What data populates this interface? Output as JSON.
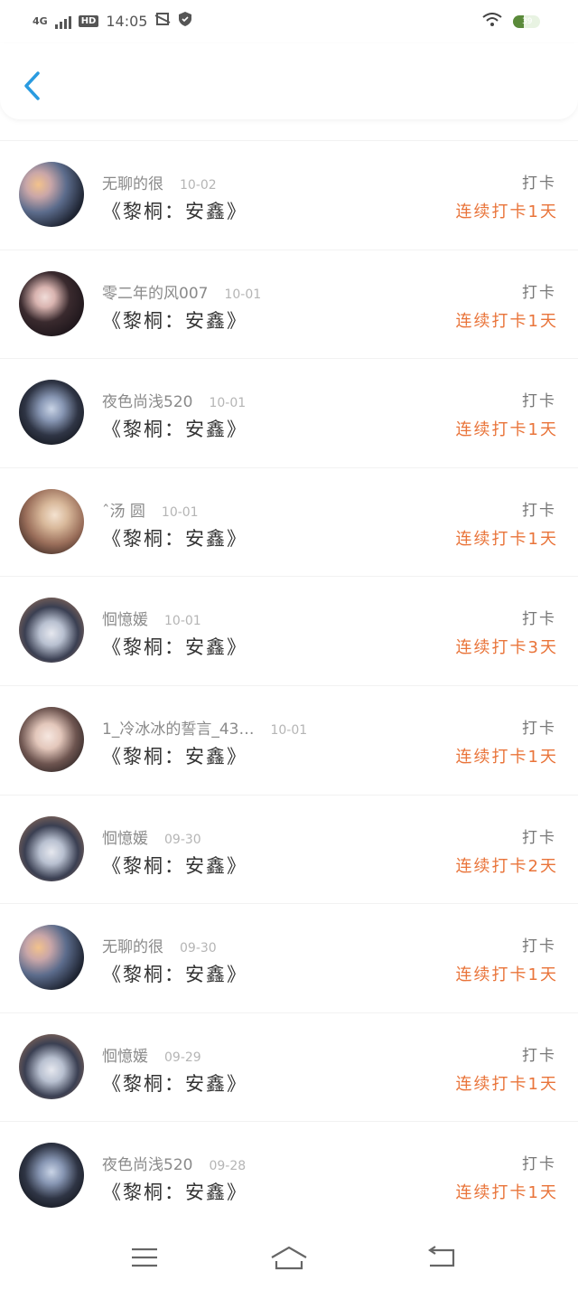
{
  "status": {
    "network": "4G",
    "hd": "HD",
    "time": "14:05",
    "battery_level": 39,
    "battery_label": "39"
  },
  "colors": {
    "accent_blue": "#2a9be0",
    "streak_orange": "#e9743a"
  },
  "entries": [
    {
      "name": "无聊的很",
      "date": "10-02",
      "book": "《黎桐：安鑫》",
      "action": "打卡",
      "streak": "连续打卡1天",
      "avatar": "avatar-sunset-mountain"
    },
    {
      "name": "零二年的风007",
      "date": "10-01",
      "book": "《黎桐：安鑫》",
      "action": "打卡",
      "streak": "连续打卡1天",
      "avatar": "avatar-girl-cat"
    },
    {
      "name": "夜色尚浅520",
      "date": "10-01",
      "book": "《黎桐：安鑫》",
      "action": "打卡",
      "streak": "连续打卡1天",
      "avatar": "avatar-couple"
    },
    {
      "name": "ˆ汤 圆",
      "date": "10-01",
      "book": "《黎桐：安鑫》",
      "action": "打卡",
      "streak": "连续打卡1天",
      "avatar": "avatar-girl-warm"
    },
    {
      "name": "恛憶媛",
      "date": "10-01",
      "book": "《黎桐：安鑫》",
      "action": "打卡",
      "streak": "连续打卡3天",
      "avatar": "avatar-girl-cap"
    },
    {
      "name": "1_冷冰冰的誓言_43…",
      "date": "10-01",
      "book": "《黎桐：安鑫》",
      "action": "打卡",
      "streak": "连续打卡1天",
      "avatar": "avatar-girl-car"
    },
    {
      "name": "恛憶媛",
      "date": "09-30",
      "book": "《黎桐：安鑫》",
      "action": "打卡",
      "streak": "连续打卡2天",
      "avatar": "avatar-girl-cap"
    },
    {
      "name": "无聊的很",
      "date": "09-30",
      "book": "《黎桐：安鑫》",
      "action": "打卡",
      "streak": "连续打卡1天",
      "avatar": "avatar-sunset-mountain"
    },
    {
      "name": "恛憶媛",
      "date": "09-29",
      "book": "《黎桐：安鑫》",
      "action": "打卡",
      "streak": "连续打卡1天",
      "avatar": "avatar-girl-cap"
    },
    {
      "name": "夜色尚浅520",
      "date": "09-28",
      "book": "《黎桐：安鑫》",
      "action": "打卡",
      "streak": "连续打卡1天",
      "avatar": "avatar-couple"
    }
  ],
  "nav": {
    "menu_icon": "menu-icon",
    "home_icon": "home-icon",
    "back_icon": "back-icon"
  }
}
